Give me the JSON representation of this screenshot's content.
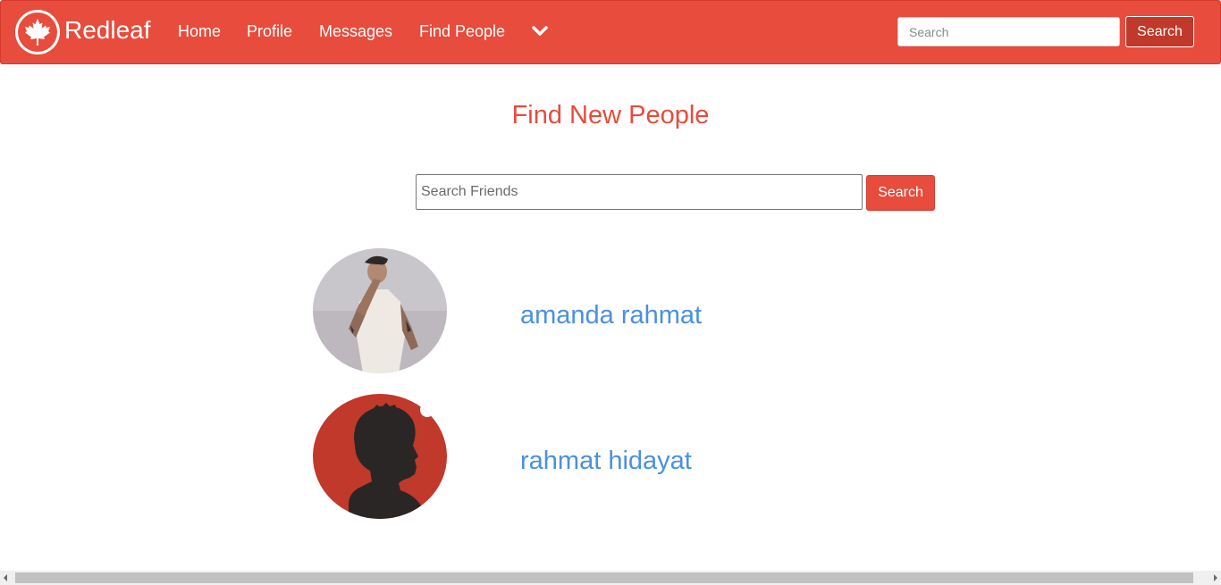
{
  "brand": {
    "name": "Redleaf",
    "logo_icon": "maple-leaf-icon"
  },
  "nav": {
    "links": [
      "Home",
      "Profile",
      "Messages",
      "Find People"
    ],
    "dropdown_icon": "chevron-down-icon"
  },
  "top_search": {
    "placeholder": "Search",
    "button_label": "Search"
  },
  "page": {
    "title": "Find New People"
  },
  "friend_search": {
    "placeholder": "Search Friends",
    "button_label": "Search"
  },
  "people": [
    {
      "name": "amanda rahmat",
      "avatar": "photo-avatar"
    },
    {
      "name": "rahmat hidayat",
      "avatar": "default-silhouette-avatar"
    }
  ],
  "colors": {
    "brand": "#e74c3c",
    "brand_dark": "#c0392b",
    "link": "#4a90e2"
  }
}
